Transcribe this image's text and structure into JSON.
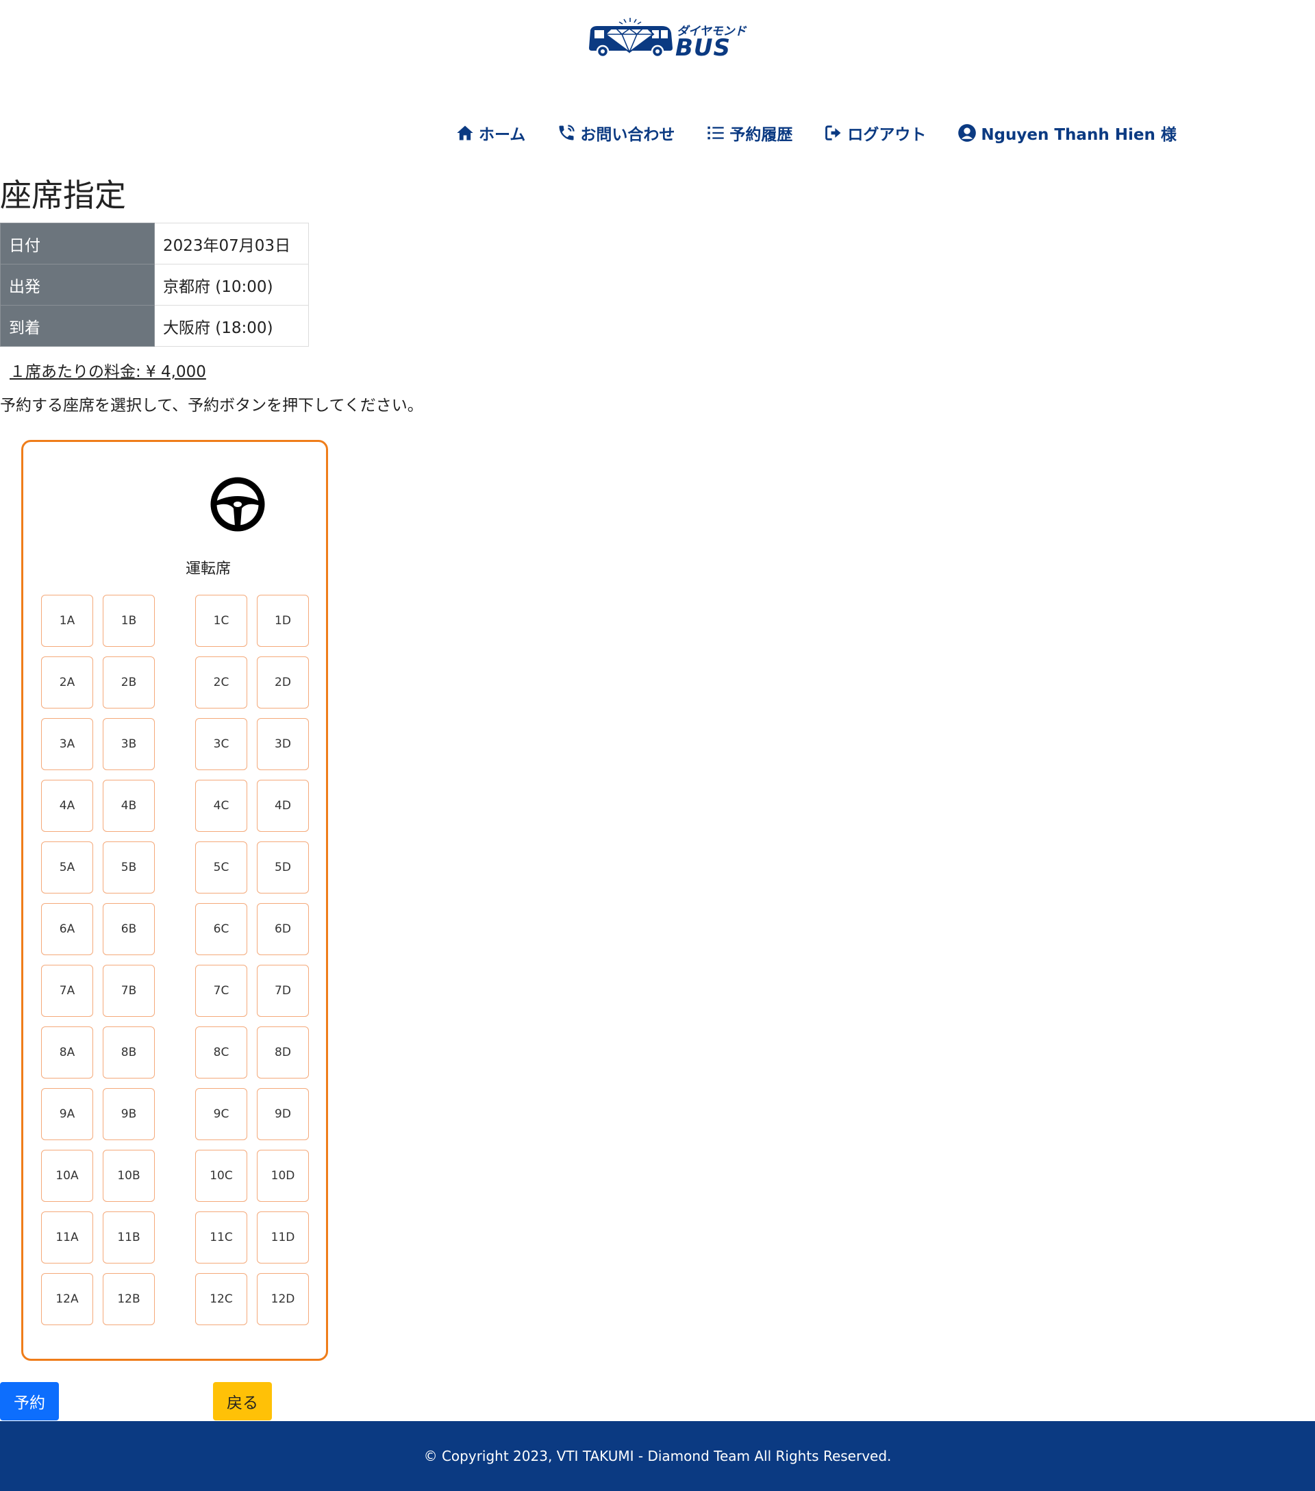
{
  "header": {
    "logo": {
      "jp_text": "ダイヤモンド",
      "bus_text": "BUS"
    },
    "nav": [
      {
        "icon": "home-icon",
        "label": "ホーム"
      },
      {
        "icon": "phone-icon",
        "label": "お問い合わせ"
      },
      {
        "icon": "list-icon",
        "label": "予約履歴"
      },
      {
        "icon": "logout-icon",
        "label": "ログアウト"
      },
      {
        "icon": "user-circle-icon",
        "label": "Nguyen Thanh Hien 様"
      }
    ]
  },
  "page": {
    "title": "座席指定",
    "info": [
      {
        "label": "日付",
        "value": "2023年07月03日"
      },
      {
        "label": "出発",
        "value": "京都府 (10:00)"
      },
      {
        "label": "到着",
        "value": "大阪府 (18:00)"
      }
    ],
    "price_text": "１席あたりの料金: ¥ 4,000",
    "instruction": "予約する座席を選択して、予約ボタンを押下してください。"
  },
  "bus": {
    "driver_label": "運転席",
    "rows": [
      [
        "1A",
        "1B",
        "1C",
        "1D"
      ],
      [
        "2A",
        "2B",
        "2C",
        "2D"
      ],
      [
        "3A",
        "3B",
        "3C",
        "3D"
      ],
      [
        "4A",
        "4B",
        "4C",
        "4D"
      ],
      [
        "5A",
        "5B",
        "5C",
        "5D"
      ],
      [
        "6A",
        "6B",
        "6C",
        "6D"
      ],
      [
        "7A",
        "7B",
        "7C",
        "7D"
      ],
      [
        "8A",
        "8B",
        "8C",
        "8D"
      ],
      [
        "9A",
        "9B",
        "9C",
        "9D"
      ],
      [
        "10A",
        "10B",
        "10C",
        "10D"
      ],
      [
        "11A",
        "11B",
        "11C",
        "11D"
      ],
      [
        "12A",
        "12B",
        "12C",
        "12D"
      ]
    ]
  },
  "buttons": {
    "reserve": "予約",
    "back": "戻る"
  },
  "footer": {
    "copyright": "© Copyright 2023, VTI TAKUMI - Diamond Team All Rights Reserved."
  },
  "colors": {
    "brand": "#0b3a82",
    "accent": "#ef7d1a",
    "seat_border": "#f4a97a",
    "reserve_button": "#0d6efd",
    "back_button": "#ffc107",
    "table_label_bg": "#6c757d"
  }
}
